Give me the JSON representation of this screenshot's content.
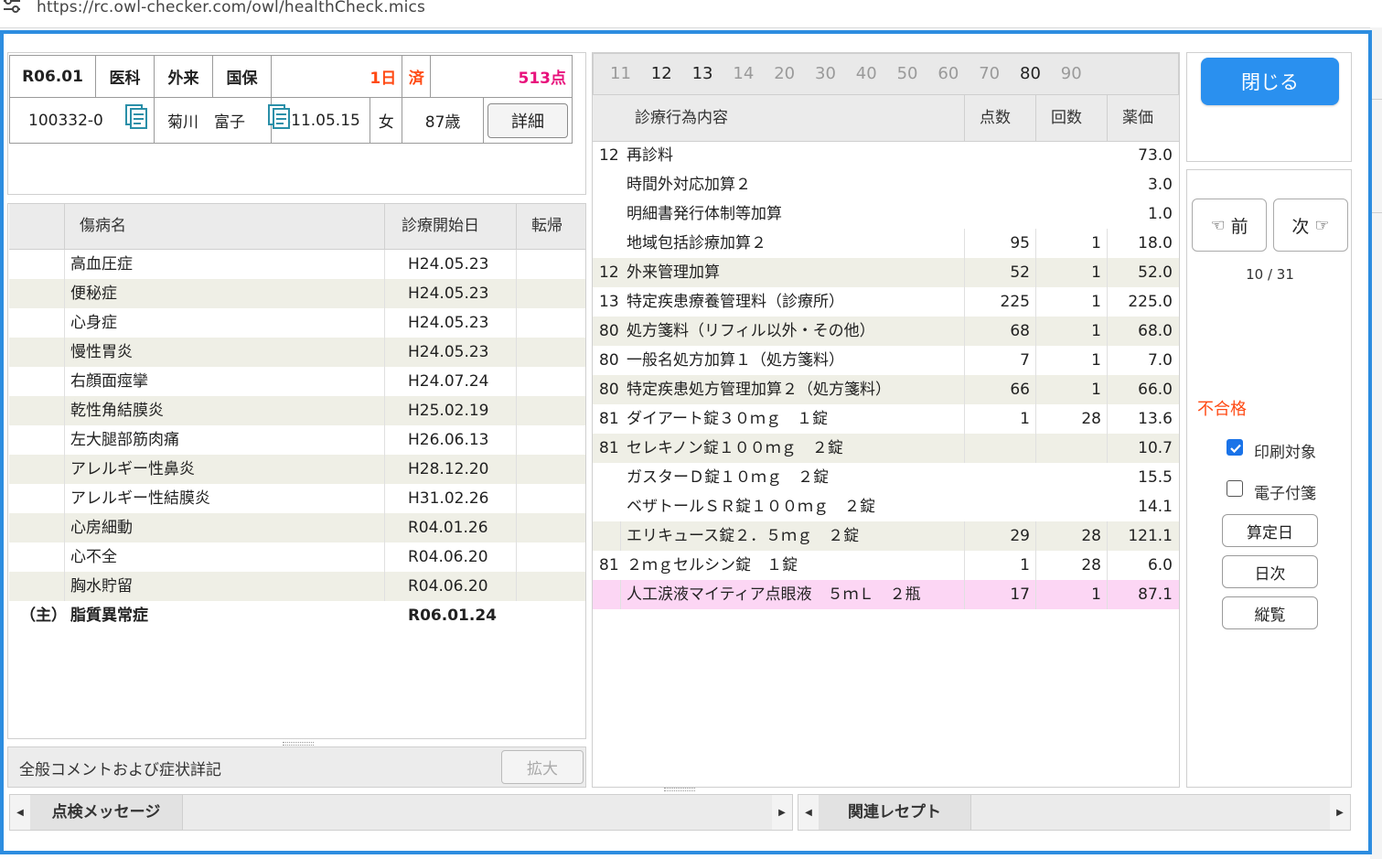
{
  "browser": {
    "url": "https://rc.owl-checker.com/owl/healthCheck.mics"
  },
  "header": {
    "row1": [
      "R06.01",
      "医科",
      "外来",
      "国保",
      "1日",
      "済",
      "513点"
    ],
    "patient_id": "100332-0",
    "patient_name": "菊川　富子",
    "birthdate": "S11.05.15",
    "sex": "女",
    "age": "87歳",
    "detail_button": "詳細"
  },
  "diseases": {
    "columns": [
      "傷病名",
      "診療開始日",
      "転帰"
    ],
    "rows": [
      {
        "mark": "",
        "name": "高血圧症",
        "date": "H24.05.23"
      },
      {
        "mark": "",
        "name": "便秘症",
        "date": "H24.05.23"
      },
      {
        "mark": "",
        "name": "心身症",
        "date": "H24.05.23"
      },
      {
        "mark": "",
        "name": "慢性胃炎",
        "date": "H24.05.23"
      },
      {
        "mark": "",
        "name": "右顔面痙攣",
        "date": "H24.07.24"
      },
      {
        "mark": "",
        "name": "乾性角結膜炎",
        "date": "H25.02.19"
      },
      {
        "mark": "",
        "name": "左大腿部筋肉痛",
        "date": "H26.06.13"
      },
      {
        "mark": "",
        "name": "アレルギー性鼻炎",
        "date": "H28.12.20"
      },
      {
        "mark": "",
        "name": "アレルギー性結膜炎",
        "date": "H31.02.26"
      },
      {
        "mark": "",
        "name": "心房細動",
        "date": "R04.01.26"
      },
      {
        "mark": "",
        "name": "心不全",
        "date": "R04.06.20"
      },
      {
        "mark": "",
        "name": "胸水貯留",
        "date": "R04.06.20"
      },
      {
        "mark": "（主）",
        "name": "脂質異常症",
        "date": "R06.01.24"
      }
    ]
  },
  "comment": {
    "label": "全般コメントおよび症状詳記",
    "expand_button": "拡大"
  },
  "section_tabs": [
    "11",
    "12",
    "13",
    "14",
    "20",
    "30",
    "40",
    "50",
    "60",
    "70",
    "80",
    "90"
  ],
  "treatments": {
    "columns": [
      "診療行為内容",
      "点数",
      "回数",
      "薬価"
    ],
    "rows": [
      {
        "code": "12",
        "content": "再診料",
        "points": "",
        "count": "",
        "price": "73.0"
      },
      {
        "code": "",
        "content": "時間外対応加算２",
        "points": "",
        "count": "",
        "price": "3.0"
      },
      {
        "code": "",
        "content": "明細書発行体制等加算",
        "points": "",
        "count": "",
        "price": "1.0"
      },
      {
        "code": "",
        "content": "地域包括診療加算２",
        "points": "95",
        "count": "1",
        "price": "18.0"
      },
      {
        "code": "12",
        "content": "外来管理加算",
        "points": "52",
        "count": "1",
        "price": "52.0"
      },
      {
        "code": "13",
        "content": "特定疾患療養管理料（診療所）",
        "points": "225",
        "count": "1",
        "price": "225.0"
      },
      {
        "code": "80",
        "content": "処方箋料（リフィル以外・その他）",
        "points": "68",
        "count": "1",
        "price": "68.0"
      },
      {
        "code": "80",
        "content": "一般名処方加算１（処方箋料）",
        "points": "7",
        "count": "1",
        "price": "7.0"
      },
      {
        "code": "80",
        "content": "特定疾患処方管理加算２（処方箋料）",
        "points": "66",
        "count": "1",
        "price": "66.0"
      },
      {
        "code": "81",
        "content": "ダイアート錠３０ｍｇ　１錠",
        "points": "1",
        "count": "28",
        "price": "13.6"
      },
      {
        "code": "81",
        "content": "セレキノン錠１００ｍｇ　２錠",
        "points": "",
        "count": "",
        "price": "10.7"
      },
      {
        "code": "",
        "content": "ガスターＤ錠１０ｍｇ　２錠",
        "points": "",
        "count": "",
        "price": "15.5"
      },
      {
        "code": "",
        "content": "ベザトールＳＲ錠１００ｍｇ　２錠",
        "points": "",
        "count": "",
        "price": "14.1"
      },
      {
        "code": "",
        "content": "エリキュース錠２．５ｍｇ　２錠",
        "points": "29",
        "count": "28",
        "price": "121.1"
      },
      {
        "code": "81",
        "content": "２ｍｇセルシン錠　１錠",
        "points": "1",
        "count": "28",
        "price": "6.0"
      },
      {
        "code": "",
        "content": "人工涙液マイティア点眼液　５ｍＬ　２瓶",
        "points": "17",
        "count": "1",
        "price": "87.1"
      }
    ]
  },
  "side": {
    "close_button": "閉じる",
    "prev_button": "前",
    "next_button": "次",
    "pager": "10 / 31",
    "status": "不合格",
    "print_target_label": "印刷対象",
    "electronic_tag_label": "電子付箋",
    "calc_date_button": "算定日",
    "daily_button": "日次",
    "vertical_view_button": "縦覧"
  },
  "bottom": {
    "left_tab": "点検メッセージ",
    "right_tab": "関連レセプト"
  },
  "colors": {
    "accent": "#2d8de0",
    "status_red": "#ff4a14",
    "points_pink": "#e8127c",
    "highlight_row": "#fcd6f4",
    "alt_row": "#efefe6"
  }
}
